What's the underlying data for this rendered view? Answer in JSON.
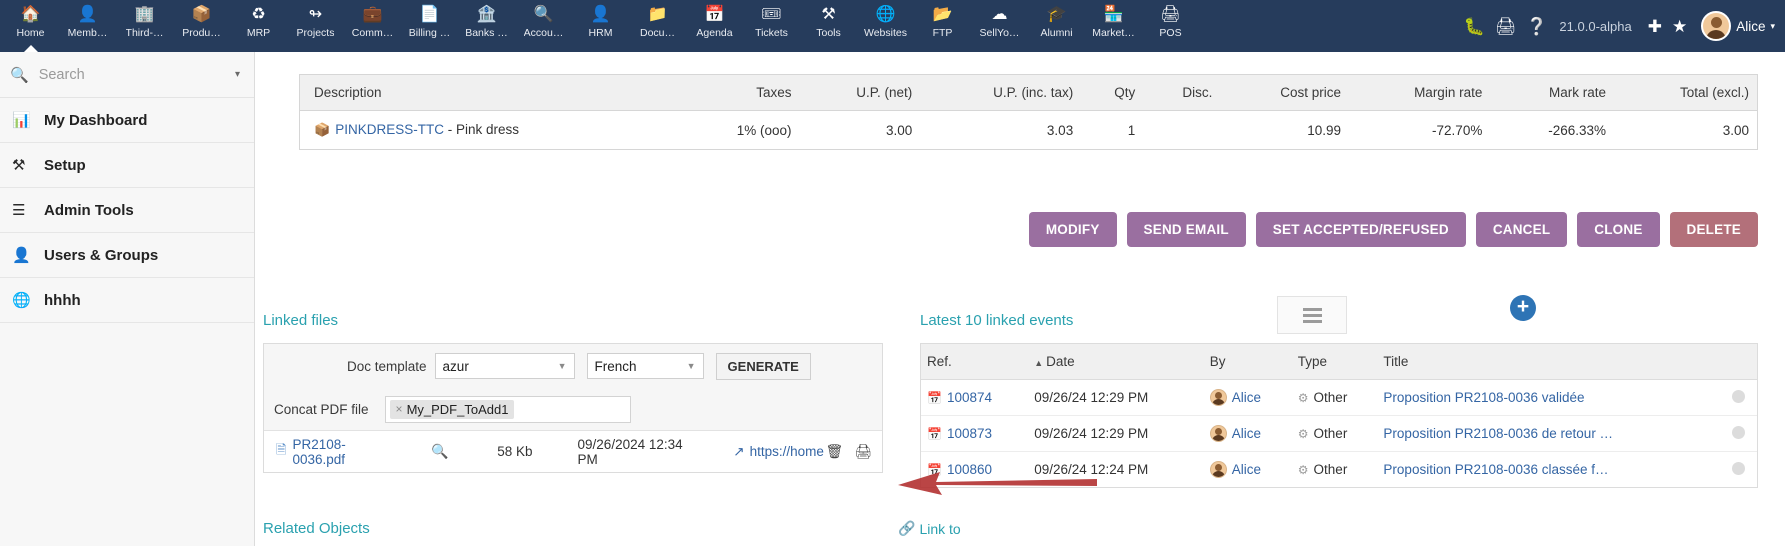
{
  "topnav": {
    "items": [
      {
        "label": "Home",
        "icon": "home-icon",
        "glyph": "⌂",
        "active": true
      },
      {
        "label": "Memb…",
        "icon": "members-icon",
        "glyph": "♟",
        "active": false
      },
      {
        "label": "Third-…",
        "icon": "third-party-icon",
        "glyph": "Ἶ2",
        "active": false
      },
      {
        "label": "Produ…",
        "icon": "products-icon",
        "glyph": "⬢",
        "active": false
      },
      {
        "label": "MRP",
        "icon": "mrp-icon",
        "glyph": "⚭",
        "active": false
      },
      {
        "label": "Projects",
        "icon": "projects-icon",
        "glyph": "⑂",
        "active": false
      },
      {
        "label": "Comm…",
        "icon": "commercial-icon",
        "glyph": "ὋC",
        "active": false
      },
      {
        "label": "Billing …",
        "icon": "billing-icon",
        "glyph": "Ὄ4",
        "active": false
      },
      {
        "label": "Banks …",
        "icon": "banks-icon",
        "glyph": "ἽB",
        "active": false
      },
      {
        "label": "Accou…",
        "icon": "accounting-icon",
        "glyph": "ὐE",
        "active": false
      },
      {
        "label": "HRM",
        "icon": "hrm-icon",
        "glyph": "὆4",
        "active": false
      },
      {
        "label": "Docu…",
        "icon": "documents-icon",
        "glyph": "Ὄ1",
        "active": false
      },
      {
        "label": "Agenda",
        "icon": "agenda-icon",
        "glyph": "Ὄ5",
        "active": false
      },
      {
        "label": "Tickets",
        "icon": "tickets-icon",
        "glyph": "ἹF",
        "active": false
      },
      {
        "label": "Tools",
        "icon": "tools-icon",
        "glyph": "⚒",
        "active": false
      },
      {
        "label": "Websites",
        "icon": "websites-icon",
        "glyph": "ἱ0",
        "active": false
      },
      {
        "label": "FTP",
        "icon": "ftp-icon",
        "glyph": "὜0",
        "active": false
      },
      {
        "label": "SellYo…",
        "icon": "sellyoursaas-icon",
        "glyph": "☁",
        "active": false
      },
      {
        "label": "Alumni",
        "icon": "alumni-icon",
        "glyph": "Ἱ3",
        "active": false
      },
      {
        "label": "Market…",
        "icon": "marketplace-icon",
        "glyph": "ἾA",
        "active": false
      },
      {
        "label": "POS",
        "icon": "pos-icon",
        "glyph": "὚8",
        "active": false
      }
    ],
    "bug_icon": "bug-icon",
    "print_icon": "printer-icon",
    "help_icon": "help-icon",
    "version": "21.0.0-alpha",
    "shield_icon": "shield-icon",
    "star_icon": "star-icon",
    "user_name": "Alice",
    "user_caret": "▾"
  },
  "sidebar": {
    "search_placeholder": "Search",
    "search_value": "",
    "search_icon": "search-icon",
    "search_caret": "▾",
    "items": [
      {
        "label": "My Dashboard",
        "icon": "dashboard-icon",
        "glyph": "ὌA"
      },
      {
        "label": "Setup",
        "icon": "setup-icon",
        "glyph": "⚒"
      },
      {
        "label": "Admin Tools",
        "icon": "admin-icon",
        "glyph": "☰"
      },
      {
        "label": "Users & Groups",
        "icon": "users-icon",
        "glyph": "὆4"
      },
      {
        "label": "hhhh",
        "icon": "globe-icon",
        "glyph": "ἱ0"
      }
    ]
  },
  "product_table": {
    "headers": [
      "Description",
      "Taxes",
      "U.P. (net)",
      "U.P. (inc. tax)",
      "Qty",
      "Disc.",
      "Cost price",
      "Margin rate",
      "Mark rate",
      "Total (excl.)"
    ],
    "rows": [
      {
        "icon": "package-icon",
        "ref": "PINKDRESS-TTC",
        "description": " - Pink dress",
        "taxes": "1% (ooo)",
        "up_net": "3.00",
        "up_inc_tax": "3.03",
        "qty": "1",
        "disc": "",
        "cost_price": "10.99",
        "margin_rate": "-72.70%",
        "mark_rate": "-266.33%",
        "total_excl": "3.00"
      }
    ]
  },
  "actions": {
    "modify": "MODIFY",
    "send_email": "SEND EMAIL",
    "set_accepted": "SET ACCEPTED/REFUSED",
    "cancel": "CANCEL",
    "clone": "CLONE",
    "delete": "DELETE"
  },
  "linked_files": {
    "title": "Linked files",
    "doc_template_label": "Doc template",
    "doc_template_value": "azur",
    "language_value": "French",
    "generate_label": "GENERATE",
    "concat_label": "Concat PDF file",
    "concat_chip": "My_PDF_ToAdd1",
    "chip_remove": "×",
    "file": {
      "icon": "pdf-file-icon",
      "name": "PR2108-0036.pdf",
      "zoom_icon": "magnifier-icon",
      "size": "58 Kb",
      "date": "09/26/2024 12:34 PM",
      "link_icon": "external-link-icon",
      "link": "https://home.c",
      "delete_icon": "trash-icon",
      "print_icon": "printer-icon"
    },
    "related_objects": "Related Objects",
    "link_to": "Link to",
    "link_to_icon": "link-icon"
  },
  "events": {
    "title": "Latest 10 linked events",
    "menu_icon": "hamburger-icon",
    "add_icon": "plus-circle-icon",
    "headers": [
      "Ref.",
      "Date",
      "By",
      "Type",
      "Title"
    ],
    "sort_indicator": "▲",
    "rows": [
      {
        "ref": "100874",
        "date": "09/26/24 12:29 PM",
        "by": "Alice",
        "type": "Other",
        "title": "Proposition PR2108-0036 validée"
      },
      {
        "ref": "100873",
        "date": "09/26/24 12:29 PM",
        "by": "Alice",
        "type": "Other",
        "title": "Proposition PR2108-0036 de retour …"
      },
      {
        "ref": "100860",
        "date": "09/26/24 12:24 PM",
        "by": "Alice",
        "type": "Other",
        "title": "Proposition PR2108-0036 classée f…"
      }
    ]
  },
  "annotation": {
    "arrow": "red-arrow-pointing-left",
    "color": "#b02b2b"
  },
  "colors": {
    "nav_bg": "#263C5C",
    "button_purple": "#9a6fa0",
    "button_delete": "#b3707a",
    "link_blue": "#3465a4",
    "panel_title_teal": "#2aa1af"
  }
}
